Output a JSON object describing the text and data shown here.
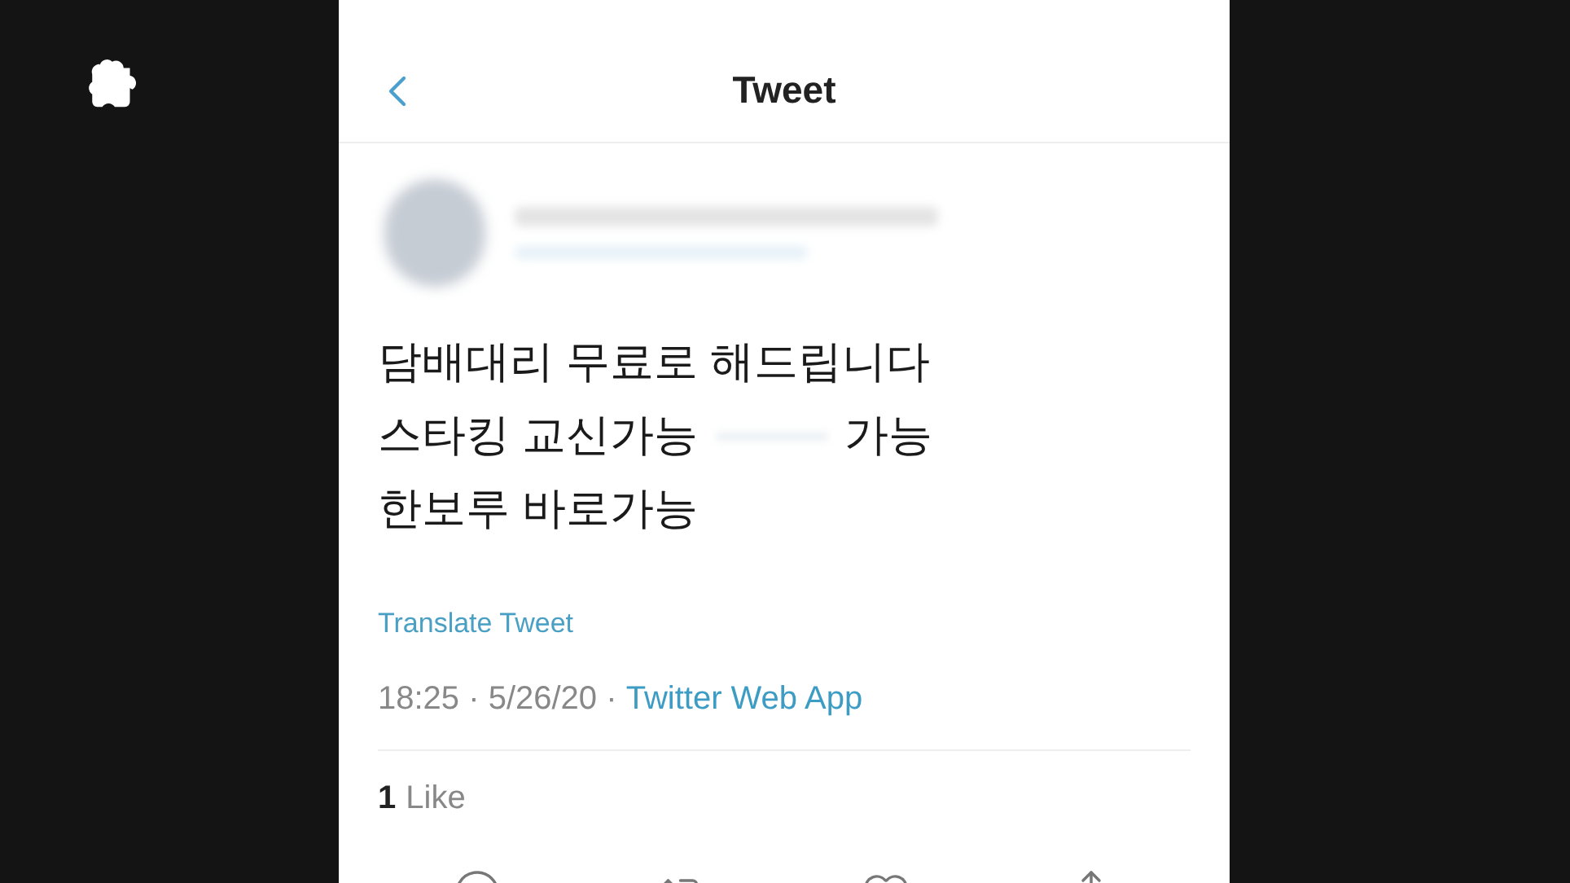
{
  "header": {
    "title": "Tweet"
  },
  "tweet": {
    "lines": [
      {
        "parts": [
          "담배대리 무료로 해드립니다"
        ]
      },
      {
        "parts": [
          "스타킹 교신가능",
          "가능"
        ]
      },
      {
        "parts": [
          "한보루 바로가능"
        ]
      }
    ],
    "translate": "Translate Tweet",
    "time": "18:25 · 5/26/20 · ",
    "source": "Twitter Web App",
    "likes": {
      "count": "1",
      "label": "Like"
    }
  }
}
